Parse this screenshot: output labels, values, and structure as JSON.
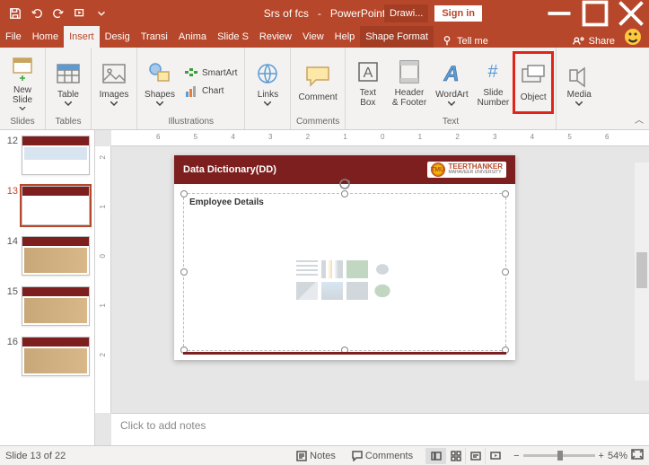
{
  "titlebar": {
    "doc_title": "Srs of fcs",
    "app_name": "PowerPoint",
    "contextual": "Drawi...",
    "signin": "Sign in"
  },
  "tabs": {
    "file": "File",
    "home": "Home",
    "insert": "Insert",
    "design": "Desig",
    "transitions": "Transi",
    "animations": "Anima",
    "slideshow": "Slide S",
    "review": "Review",
    "view": "View",
    "help": "Help",
    "shapeformat": "Shape Format",
    "tellme": "Tell me",
    "share": "Share"
  },
  "ribbon": {
    "newslide": "New\nSlide",
    "slides": "Slides",
    "table": "Table",
    "tables": "Tables",
    "images": "Images",
    "shapes": "Shapes",
    "smartart": "SmartArt",
    "chart": "Chart",
    "illustrations": "Illustrations",
    "links": "Links",
    "comment": "Comment",
    "comments": "Comments",
    "textbox": "Text\nBox",
    "headerfooter": "Header\n& Footer",
    "wordart": "WordArt",
    "slidenumber": "Slide\nNumber",
    "object": "Object",
    "text": "Text",
    "media": "Media"
  },
  "thumbs": {
    "n12": "12",
    "n13": "13",
    "n14": "14",
    "n15": "15",
    "n16": "16"
  },
  "slide": {
    "title": "Data Dictionary(DD)",
    "uni_abbr": "TMU",
    "uni_name": "TEERTHANKER",
    "uni_sub": "MAHAVEER UNIVERSITY",
    "subtitle": "Employee Details"
  },
  "notes_placeholder": "Click to add notes",
  "status": {
    "slide": "Slide 13 of 22",
    "notes": "Notes",
    "comments": "Comments",
    "zoom": "54%"
  },
  "ruler_h": [
    "6",
    "5",
    "4",
    "3",
    "2",
    "1",
    "0",
    "1",
    "2",
    "3",
    "4",
    "5",
    "6"
  ],
  "ruler_v": [
    "2",
    "1",
    "0",
    "1",
    "2"
  ]
}
